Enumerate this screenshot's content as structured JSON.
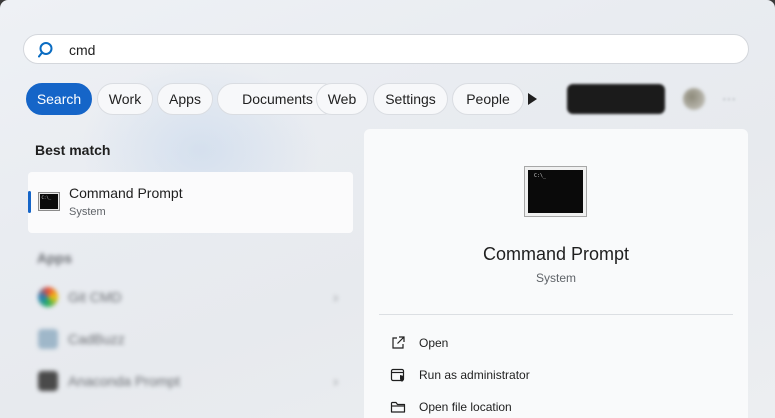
{
  "search": {
    "value": "cmd"
  },
  "filters": [
    "Search",
    "Work",
    "Apps",
    "Documents",
    "Web",
    "Settings",
    "People"
  ],
  "colors": {
    "accent": "#1565c8"
  },
  "best_match": {
    "heading": "Best match",
    "title": "Command Prompt",
    "subtitle": "System",
    "icon": "command-prompt-icon"
  },
  "apps": {
    "heading": "Apps",
    "items": [
      {
        "label": "Git CMD",
        "icon": "git-icon"
      },
      {
        "label": "CadBuzz",
        "icon": "app-icon"
      },
      {
        "label": "Anaconda Prompt",
        "icon": "anaconda-icon"
      }
    ]
  },
  "detail": {
    "title": "Command Prompt",
    "subtitle": "System",
    "actions": [
      {
        "label": "Open",
        "icon": "open-external-icon"
      },
      {
        "label": "Run as administrator",
        "icon": "shield-admin-icon"
      },
      {
        "label": "Open file location",
        "icon": "folder-icon"
      }
    ]
  }
}
